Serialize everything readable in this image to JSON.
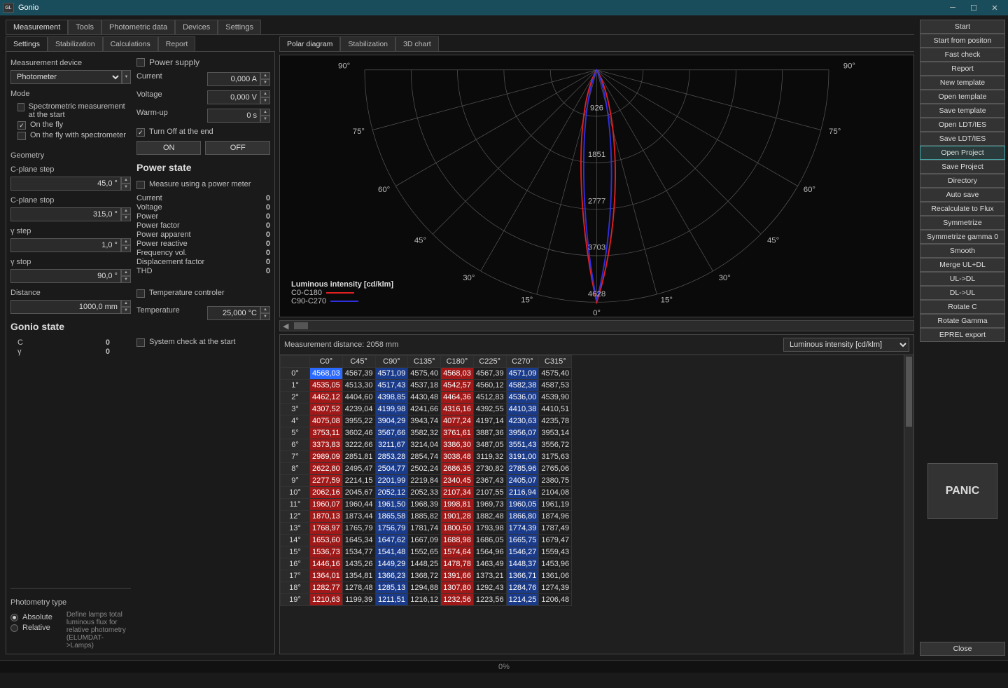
{
  "window": {
    "title": "Gonio"
  },
  "main_tabs": [
    "Measurement",
    "Tools",
    "Photometric data",
    "Devices",
    "Settings"
  ],
  "sub_tabs_left": [
    "Settings",
    "Stabilization",
    "Calculations",
    "Report"
  ],
  "sub_tabs_right": [
    "Polar diagram",
    "Stabilization",
    "3D chart"
  ],
  "settings": {
    "md_label": "Measurement device",
    "device": "Photometer",
    "mode_label": "Mode",
    "mode_spec": "Spectrometric measurement at the start",
    "mode_fly": "On the fly",
    "mode_fly_spec": "On the fly with spectrometer",
    "geom_label": "Geometry",
    "cplane_step_label": "C-plane step",
    "cplane_step": "45,0 °",
    "cplane_stop_label": "C-plane stop",
    "cplane_stop": "315,0 °",
    "gstep_label": "γ step",
    "gstep": "1,0 °",
    "gstop_label": "γ stop",
    "gstop": "90,0 °",
    "dist_label": "Distance",
    "dist": "1000,0 mm",
    "gonio_state_label": "Gonio state",
    "gs_c_label": "C",
    "gs_c": "0",
    "gs_g_label": "γ",
    "gs_g": "0",
    "ps_label": "Power supply",
    "ps_current_label": "Current",
    "ps_current": "0,000 A",
    "ps_voltage_label": "Voltage",
    "ps_voltage": "0,000 V",
    "ps_warm_label": "Warm-up",
    "ps_warm": "0 s",
    "ps_turnoff": "Turn Off at the end",
    "on": "ON",
    "off": "OFF",
    "pstate_label": "Power state",
    "pstate_meter": "Measure using a power meter",
    "pstate_rows": [
      [
        "Current",
        "0"
      ],
      [
        "Voltage",
        "0"
      ],
      [
        "Power",
        "0"
      ],
      [
        "Power factor",
        "0"
      ],
      [
        "Power apparent",
        "0"
      ],
      [
        "Power reactive",
        "0"
      ],
      [
        "Frequency vol.",
        "0"
      ],
      [
        "Displacement factor",
        "0"
      ],
      [
        "THD",
        "0"
      ]
    ],
    "temp_ctrl_label": "Temperature controler",
    "temp_label": "Temperature",
    "temp": "25,000 °C",
    "syscheck": "System check at the start",
    "phot_type_label": "Photometry type",
    "abs": "Absolute",
    "rel": "Relative",
    "phot_hint": "Define lamps total luminous flux for relative photometry (ELUMDAT->Lamps)"
  },
  "chart": {
    "title": "Luminous intensity [cd/klm]",
    "s1": "C0-C180",
    "s2": "C90-C270",
    "ring_labels": [
      "926",
      "1851",
      "2777",
      "3703",
      "4628"
    ],
    "angle_labels": [
      "90°",
      "75°",
      "60°",
      "45°",
      "30°",
      "15°",
      "0°"
    ]
  },
  "data": {
    "meas_dist": "Measurement distance: 2058 mm",
    "unit_label": "Luminous intensity [cd/klm]",
    "cols": [
      "C0°",
      "C45°",
      "C90°",
      "C135°",
      "C180°",
      "C225°",
      "C270°",
      "C315°"
    ],
    "rows": [
      {
        "h": "0°",
        "c": [
          "4568,03",
          "4567,39",
          "4571,09",
          "4575,40",
          "4568,03",
          "4567,39",
          "4571,09",
          "4575,40"
        ]
      },
      {
        "h": "1°",
        "c": [
          "4535,05",
          "4513,30",
          "4517,43",
          "4537,18",
          "4542,57",
          "4560,12",
          "4582,38",
          "4587,53"
        ]
      },
      {
        "h": "2°",
        "c": [
          "4462,12",
          "4404,60",
          "4398,85",
          "4430,48",
          "4464,36",
          "4512,83",
          "4536,00",
          "4539,90"
        ]
      },
      {
        "h": "3°",
        "c": [
          "4307,52",
          "4239,04",
          "4199,98",
          "4241,66",
          "4316,16",
          "4392,55",
          "4410,38",
          "4410,51"
        ]
      },
      {
        "h": "4°",
        "c": [
          "4075,08",
          "3955,22",
          "3904,29",
          "3943,74",
          "4077,24",
          "4197,14",
          "4230,63",
          "4235,78"
        ]
      },
      {
        "h": "5°",
        "c": [
          "3753,11",
          "3602,46",
          "3567,66",
          "3582,32",
          "3761,61",
          "3887,36",
          "3956,07",
          "3953,14"
        ]
      },
      {
        "h": "6°",
        "c": [
          "3373,83",
          "3222,66",
          "3211,67",
          "3214,04",
          "3386,30",
          "3487,05",
          "3551,43",
          "3556,72"
        ]
      },
      {
        "h": "7°",
        "c": [
          "2989,09",
          "2851,81",
          "2853,28",
          "2854,74",
          "3038,48",
          "3119,32",
          "3191,00",
          "3175,63"
        ]
      },
      {
        "h": "8°",
        "c": [
          "2622,80",
          "2495,47",
          "2504,77",
          "2502,24",
          "2686,35",
          "2730,82",
          "2785,96",
          "2765,06"
        ]
      },
      {
        "h": "9°",
        "c": [
          "2277,59",
          "2214,15",
          "2201,99",
          "2219,84",
          "2340,45",
          "2367,43",
          "2405,07",
          "2380,75"
        ]
      },
      {
        "h": "10°",
        "c": [
          "2062,16",
          "2045,67",
          "2052,12",
          "2052,33",
          "2107,34",
          "2107,55",
          "2116,94",
          "2104,08"
        ]
      },
      {
        "h": "11°",
        "c": [
          "1960,07",
          "1960,44",
          "1961,50",
          "1968,39",
          "1998,81",
          "1969,73",
          "1960,05",
          "1961,19"
        ]
      },
      {
        "h": "12°",
        "c": [
          "1870,13",
          "1873,44",
          "1865,58",
          "1885,82",
          "1901,28",
          "1882,48",
          "1866,80",
          "1874,96"
        ]
      },
      {
        "h": "13°",
        "c": [
          "1768,97",
          "1765,79",
          "1756,79",
          "1781,74",
          "1800,50",
          "1793,98",
          "1774,39",
          "1787,49"
        ]
      },
      {
        "h": "14°",
        "c": [
          "1653,60",
          "1645,34",
          "1647,62",
          "1667,09",
          "1688,98",
          "1686,05",
          "1665,75",
          "1679,47"
        ]
      },
      {
        "h": "15°",
        "c": [
          "1536,73",
          "1534,77",
          "1541,48",
          "1552,65",
          "1574,64",
          "1564,96",
          "1546,27",
          "1559,43"
        ]
      },
      {
        "h": "16°",
        "c": [
          "1446,16",
          "1435,26",
          "1449,29",
          "1448,25",
          "1478,78",
          "1463,49",
          "1448,37",
          "1453,96"
        ]
      },
      {
        "h": "17°",
        "c": [
          "1364,01",
          "1354,81",
          "1366,23",
          "1368,72",
          "1391,66",
          "1373,21",
          "1366,71",
          "1361,06"
        ]
      },
      {
        "h": "18°",
        "c": [
          "1282,77",
          "1278,48",
          "1285,13",
          "1294,88",
          "1307,80",
          "1292,43",
          "1284,76",
          "1274,39"
        ]
      },
      {
        "h": "19°",
        "c": [
          "1210,63",
          "1199,39",
          "1211,51",
          "1216,12",
          "1232,56",
          "1223,56",
          "1214,25",
          "1206,48"
        ]
      }
    ],
    "colstyle": [
      "red",
      "",
      "blue",
      "",
      "red",
      "",
      "blue",
      ""
    ]
  },
  "side_buttons": [
    "Start",
    "Start from positon",
    "Fast check",
    "Report",
    "New template",
    "Open template",
    "Save template",
    "Open LDT/IES",
    "Save LDT/IES",
    "Open Project",
    "Save Project",
    "Directory",
    "Auto save",
    "Recalculate to Flux",
    "Symmetrize",
    "Symmetrize gamma 0",
    "Smooth",
    "Merge UL+DL",
    "UL->DL",
    "DL->UL",
    "Rotate C",
    "Rotate Gamma",
    "EPREL export"
  ],
  "side_hl_index": 9,
  "panic": "PANIC",
  "close": "Close",
  "status": "0%"
}
